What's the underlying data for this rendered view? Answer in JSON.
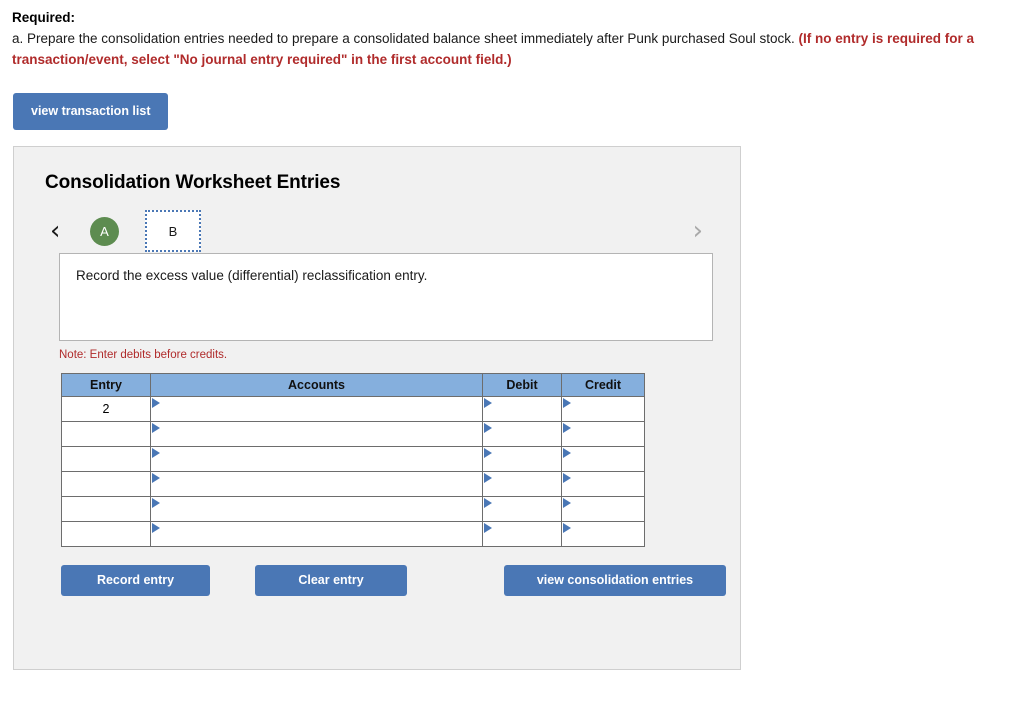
{
  "prompt": {
    "required_label": "Required:",
    "body_part1": "a. Prepare the consolidation entries needed to prepare a consolidated balance sheet immediately after Punk purchased Soul stock. ",
    "body_warning": "(If no entry is required for a transaction/event, select \"No journal entry required\" in the first account field.)"
  },
  "toolbar": {
    "view_transaction_list": "view transaction list"
  },
  "panel": {
    "title": "Consolidation Worksheet Entries",
    "nav": {
      "prev_icon": "‹",
      "next_icon": "›",
      "tabs": [
        {
          "label": "A",
          "state": "completed",
          "style": "circle-green"
        },
        {
          "label": "B",
          "state": "selected",
          "style": "box-dotted"
        }
      ]
    },
    "instruction": "Record the excess value (differential) reclassification entry.",
    "note": "Note: Enter debits before credits.",
    "table": {
      "columns": [
        "Entry",
        "Accounts",
        "Debit",
        "Credit"
      ],
      "rows": [
        {
          "entry": "2",
          "accounts": "",
          "debit": "",
          "credit": ""
        },
        {
          "entry": "",
          "accounts": "",
          "debit": "",
          "credit": ""
        },
        {
          "entry": "",
          "accounts": "",
          "debit": "",
          "credit": ""
        },
        {
          "entry": "",
          "accounts": "",
          "debit": "",
          "credit": ""
        },
        {
          "entry": "",
          "accounts": "",
          "debit": "",
          "credit": ""
        },
        {
          "entry": "",
          "accounts": "",
          "debit": "",
          "credit": ""
        }
      ]
    },
    "buttons": {
      "record_entry": "Record entry",
      "clear_entry": "Clear entry",
      "view_consolidation_entries": "view consolidation entries"
    }
  },
  "colors": {
    "button_blue": "#4a77b5",
    "table_header_blue": "#85afdd",
    "tab_green": "#5d8c50",
    "warning_red": "#b02b2b",
    "panel_bg": "#f1f1f1"
  }
}
